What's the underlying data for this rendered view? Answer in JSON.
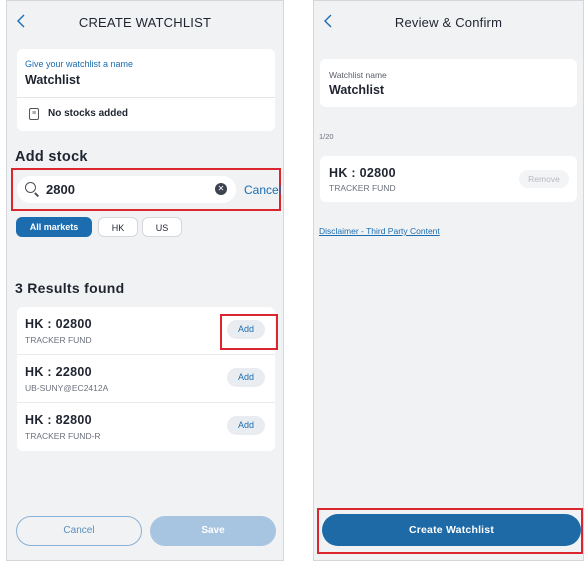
{
  "screen1": {
    "title": "CREATE WATCHLIST",
    "back_icon": "chevron-left-icon",
    "name_label": "Give your watchlist a name",
    "name_value": "Watchlist",
    "no_stocks": "No stocks added",
    "add_stock_heading": "Add stock",
    "search": {
      "query": "2800",
      "cancel_label": "Cancel"
    },
    "market_tabs": [
      {
        "label": "All markets",
        "active": true
      },
      {
        "label": "HK",
        "active": false
      },
      {
        "label": "US",
        "active": false
      }
    ],
    "results_heading": "3 Results found",
    "results": [
      {
        "code": "HK : 02800",
        "name": "TRACKER FUND",
        "action": "Add"
      },
      {
        "code": "HK : 22800",
        "name": "UB-SUNY@EC2412A",
        "action": "Add"
      },
      {
        "code": "HK : 82800",
        "name": "TRACKER FUND-R",
        "action": "Add"
      }
    ],
    "cancel_button": "Cancel",
    "save_button": "Save"
  },
  "screen2": {
    "title": "Review & Confirm",
    "back_icon": "chevron-left-icon",
    "watchlist_label": "Watchlist name",
    "watchlist_value": "Watchlist",
    "count": "1/20",
    "stock": {
      "code": "HK : 02800",
      "name": "TRACKER FUND",
      "remove_label": "Remove"
    },
    "disclaimer": "Disclaimer - Third Party Content",
    "create_button": "Create Watchlist"
  },
  "colors": {
    "accent": "#1b6db0",
    "highlight": "#d9262f",
    "background": "#f1f2f4"
  }
}
